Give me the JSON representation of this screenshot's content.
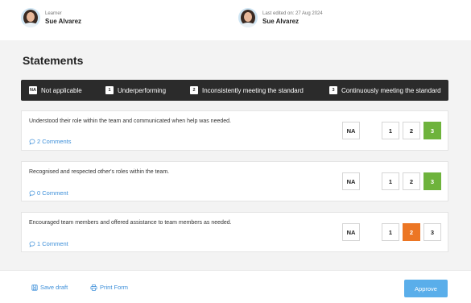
{
  "header": {
    "learner": {
      "label": "Learner",
      "name": "Sue Alvarez"
    },
    "editor": {
      "label": "Last edited on: 27 Aug 2024",
      "name": "Sue Alvarez"
    }
  },
  "title": "Statements",
  "legend": [
    {
      "key": "NA",
      "label": "Not applicable"
    },
    {
      "key": "1",
      "label": "Underperforming"
    },
    {
      "key": "2",
      "label": "Inconsistently meeting the standard"
    },
    {
      "key": "3",
      "label": "Continuously meeting the standard"
    }
  ],
  "options": {
    "na": "NA",
    "o1": "1",
    "o2": "2",
    "o3": "3"
  },
  "statements": [
    {
      "text": "Understood their role within the team and communicated when help was needed.",
      "comments": "2 Comments",
      "selected": "3",
      "selected_color": "#6eb33c"
    },
    {
      "text": "Recognised and respected other's roles within the team.",
      "comments": "0 Comment",
      "selected": "3",
      "selected_color": "#6eb33c"
    },
    {
      "text": "Encouraged team members and offered assistance to team members as needed.",
      "comments": "1 Comment",
      "selected": "2",
      "selected_color": "#ec7624"
    }
  ],
  "footer": {
    "save_label": "Save draft",
    "print_label": "Print Form",
    "approve_label": "Approve"
  },
  "colors": {
    "accent": "#3d8fd9",
    "approve": "#5aaeea",
    "green": "#6eb33c",
    "orange": "#ec7624",
    "legend_bg": "#2b2b2b"
  }
}
